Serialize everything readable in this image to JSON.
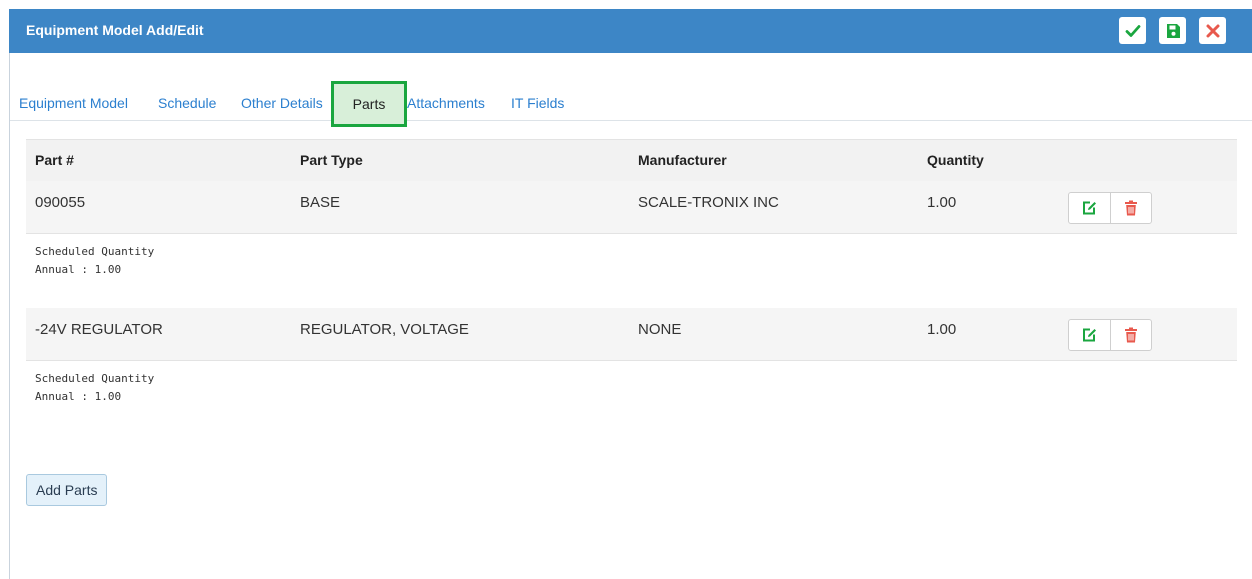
{
  "header": {
    "title": "Equipment Model Add/Edit"
  },
  "tabs": [
    {
      "label": "Equipment Model"
    },
    {
      "label": "Schedule"
    },
    {
      "label": "Other Details"
    },
    {
      "label": "Parts"
    },
    {
      "label": "Attachments"
    },
    {
      "label": "IT Fields"
    }
  ],
  "active_tab": "Parts",
  "table": {
    "headers": [
      "Part #",
      "Part Type",
      "Manufacturer",
      "Quantity"
    ],
    "rows": [
      {
        "part": "090055",
        "type": "BASE",
        "manufacturer": "SCALE-TRONIX INC",
        "quantity": "1.00",
        "sched_label": "Scheduled Quantity",
        "sched_value": "Annual : 1.00"
      },
      {
        "part": "-24V REGULATOR",
        "type": "REGULATOR, VOLTAGE",
        "manufacturer": "NONE",
        "quantity": "1.00",
        "sched_label": "Scheduled Quantity",
        "sched_value": "Annual : 1.00"
      }
    ]
  },
  "add_parts_label": "Add Parts",
  "colors": {
    "header_bg": "#3d86c6",
    "accent_green": "#1aa63f",
    "delete_red": "#e8594d",
    "link_blue": "#2b7fcf"
  },
  "icons": [
    "check-icon",
    "save-icon",
    "close-icon",
    "edit-icon",
    "trash-icon"
  ]
}
